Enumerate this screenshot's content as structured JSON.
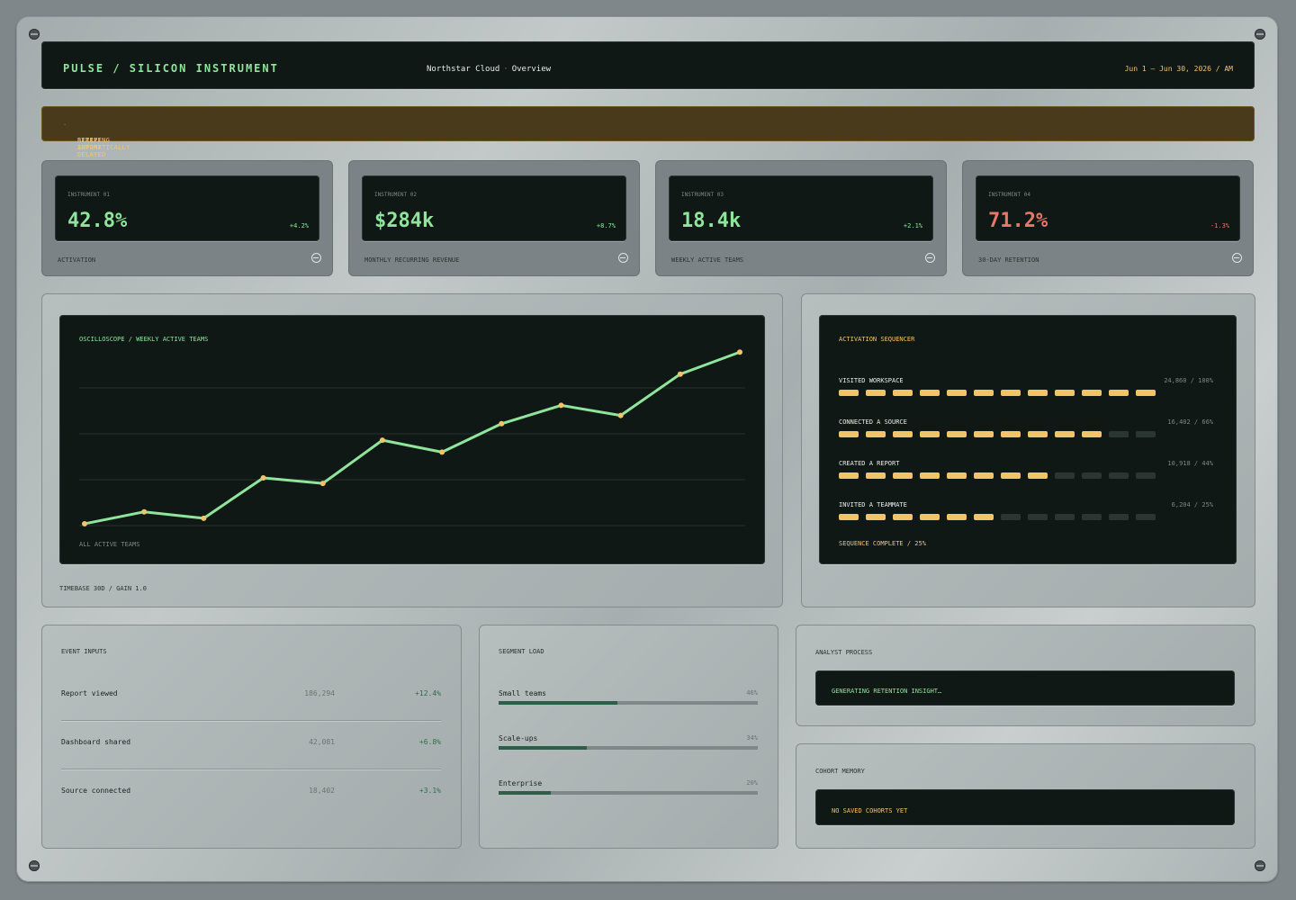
{
  "header": {
    "brand": "PULSE / SILICON INSTRUMENT",
    "workspace": "Northstar Cloud",
    "view": "Overview",
    "date_range": "Jun 1 – Jun 30, 2026 / AM"
  },
  "alert": {
    "message": "Stripe import delayed",
    "status": "Retrying automatically",
    "color": "#f4c56c"
  },
  "kpis": [
    {
      "instrument": "Instrument 01",
      "value": "42.8%",
      "delta": "+4.2%",
      "label": "Activation",
      "trend": "up"
    },
    {
      "instrument": "Instrument 02",
      "value": "$284k",
      "delta": "+8.7%",
      "label": "Monthly recurring revenue",
      "trend": "up"
    },
    {
      "instrument": "Instrument 03",
      "value": "18.4k",
      "delta": "+2.1%",
      "label": "Weekly active teams",
      "trend": "up"
    },
    {
      "instrument": "Instrument 04",
      "value": "71.2%",
      "delta": "-1.3%",
      "label": "30-day retention",
      "trend": "down"
    }
  ],
  "scope": {
    "title": "Oscilloscope / Weekly active teams",
    "series_label": "All active teams",
    "footer": "Timebase 30D / Gain 1.0"
  },
  "chart_data": {
    "type": "line",
    "title": "Oscilloscope / Weekly active teams",
    "x": [
      1,
      2,
      3,
      4,
      5,
      6,
      7,
      8,
      9,
      10,
      11,
      12
    ],
    "series": [
      {
        "name": "All active teams",
        "values": [
          2,
          15,
          8,
          52,
          46,
          93,
          80,
          111,
          131,
          120,
          165,
          189
        ]
      }
    ],
    "ylim": [
      0,
      200
    ],
    "grid": true,
    "line_color": "#8fe59b",
    "point_color": "#f1c46a"
  },
  "sequencer": {
    "title": "Activation sequencer",
    "steps": [
      {
        "name": "Visited workspace",
        "count": "24,860 / 100%",
        "filled": 12,
        "total": 12
      },
      {
        "name": "Connected a source",
        "count": "16,402 / 66%",
        "filled": 10,
        "total": 12
      },
      {
        "name": "Created a report",
        "count": "10,918 / 44%",
        "filled": 8,
        "total": 12
      },
      {
        "name": "Invited a teammate",
        "count": "6,204 / 25%",
        "filled": 6,
        "total": 12
      }
    ],
    "complete": "Sequence complete / 25%"
  },
  "events": {
    "title": "Event inputs",
    "rows": [
      {
        "name": "Report viewed",
        "count": "186,294",
        "delta": "+12.4%"
      },
      {
        "name": "Dashboard shared",
        "count": "42,081",
        "delta": "+6.8%"
      },
      {
        "name": "Source connected",
        "count": "18,402",
        "delta": "+3.1%"
      }
    ]
  },
  "segments": {
    "title": "Segment load",
    "rows": [
      {
        "name": "Small teams",
        "pct_label": "46%",
        "pct": 46
      },
      {
        "name": "Scale-ups",
        "pct_label": "34%",
        "pct": 34
      },
      {
        "name": "Enterprise",
        "pct_label": "20%",
        "pct": 20
      }
    ]
  },
  "analyst": {
    "title": "Analyst process",
    "status": "Generating retention insight…"
  },
  "cohort": {
    "title": "Cohort memory",
    "status": "No saved cohorts yet"
  }
}
